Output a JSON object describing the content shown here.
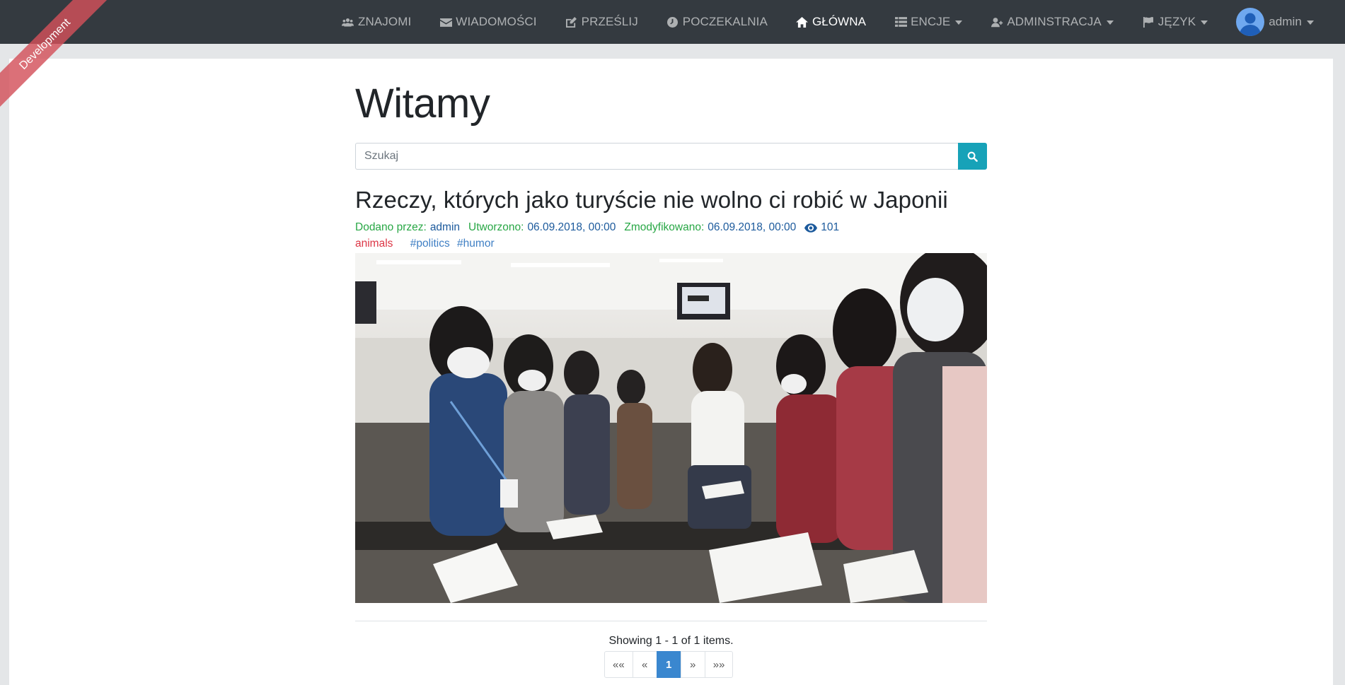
{
  "ribbon": "Development",
  "nav": {
    "friends": "ZNAJOMI",
    "messages": "WIADOMOŚCI",
    "upload": "PRZEŚLIJ",
    "waiting_room": "POCZEKALNIA",
    "home": "GŁÓWNA",
    "entities": "ENCJE",
    "administration": "ADMINSTRACJA",
    "language": "JĘZYK",
    "user": "admin"
  },
  "page": {
    "title": "Witamy"
  },
  "search": {
    "placeholder": "Szukaj"
  },
  "article": {
    "title": "Rzeczy, których jako turyście nie wolno ci robić w Japonii",
    "added_by_label": "Dodano przez:",
    "author": "admin",
    "created_label": "Utworzono:",
    "created": "06.09.2018, 00:00",
    "modified_label": "Zmodyfikowano:",
    "modified": "06.09.2018, 00:00",
    "views": "101",
    "category": "animals",
    "tags": [
      "#politics",
      "#humor"
    ]
  },
  "pagination": {
    "summary": "Showing 1 - 1 of 1 items.",
    "first": "««",
    "prev": "«",
    "current": "1",
    "next": "»",
    "last": "»»"
  },
  "colors": {
    "navbar": "#343a40",
    "search_button": "#17a2b8",
    "meta_green": "#28a745",
    "category_red": "#dc3545",
    "pager_active": "#3a87cf"
  }
}
